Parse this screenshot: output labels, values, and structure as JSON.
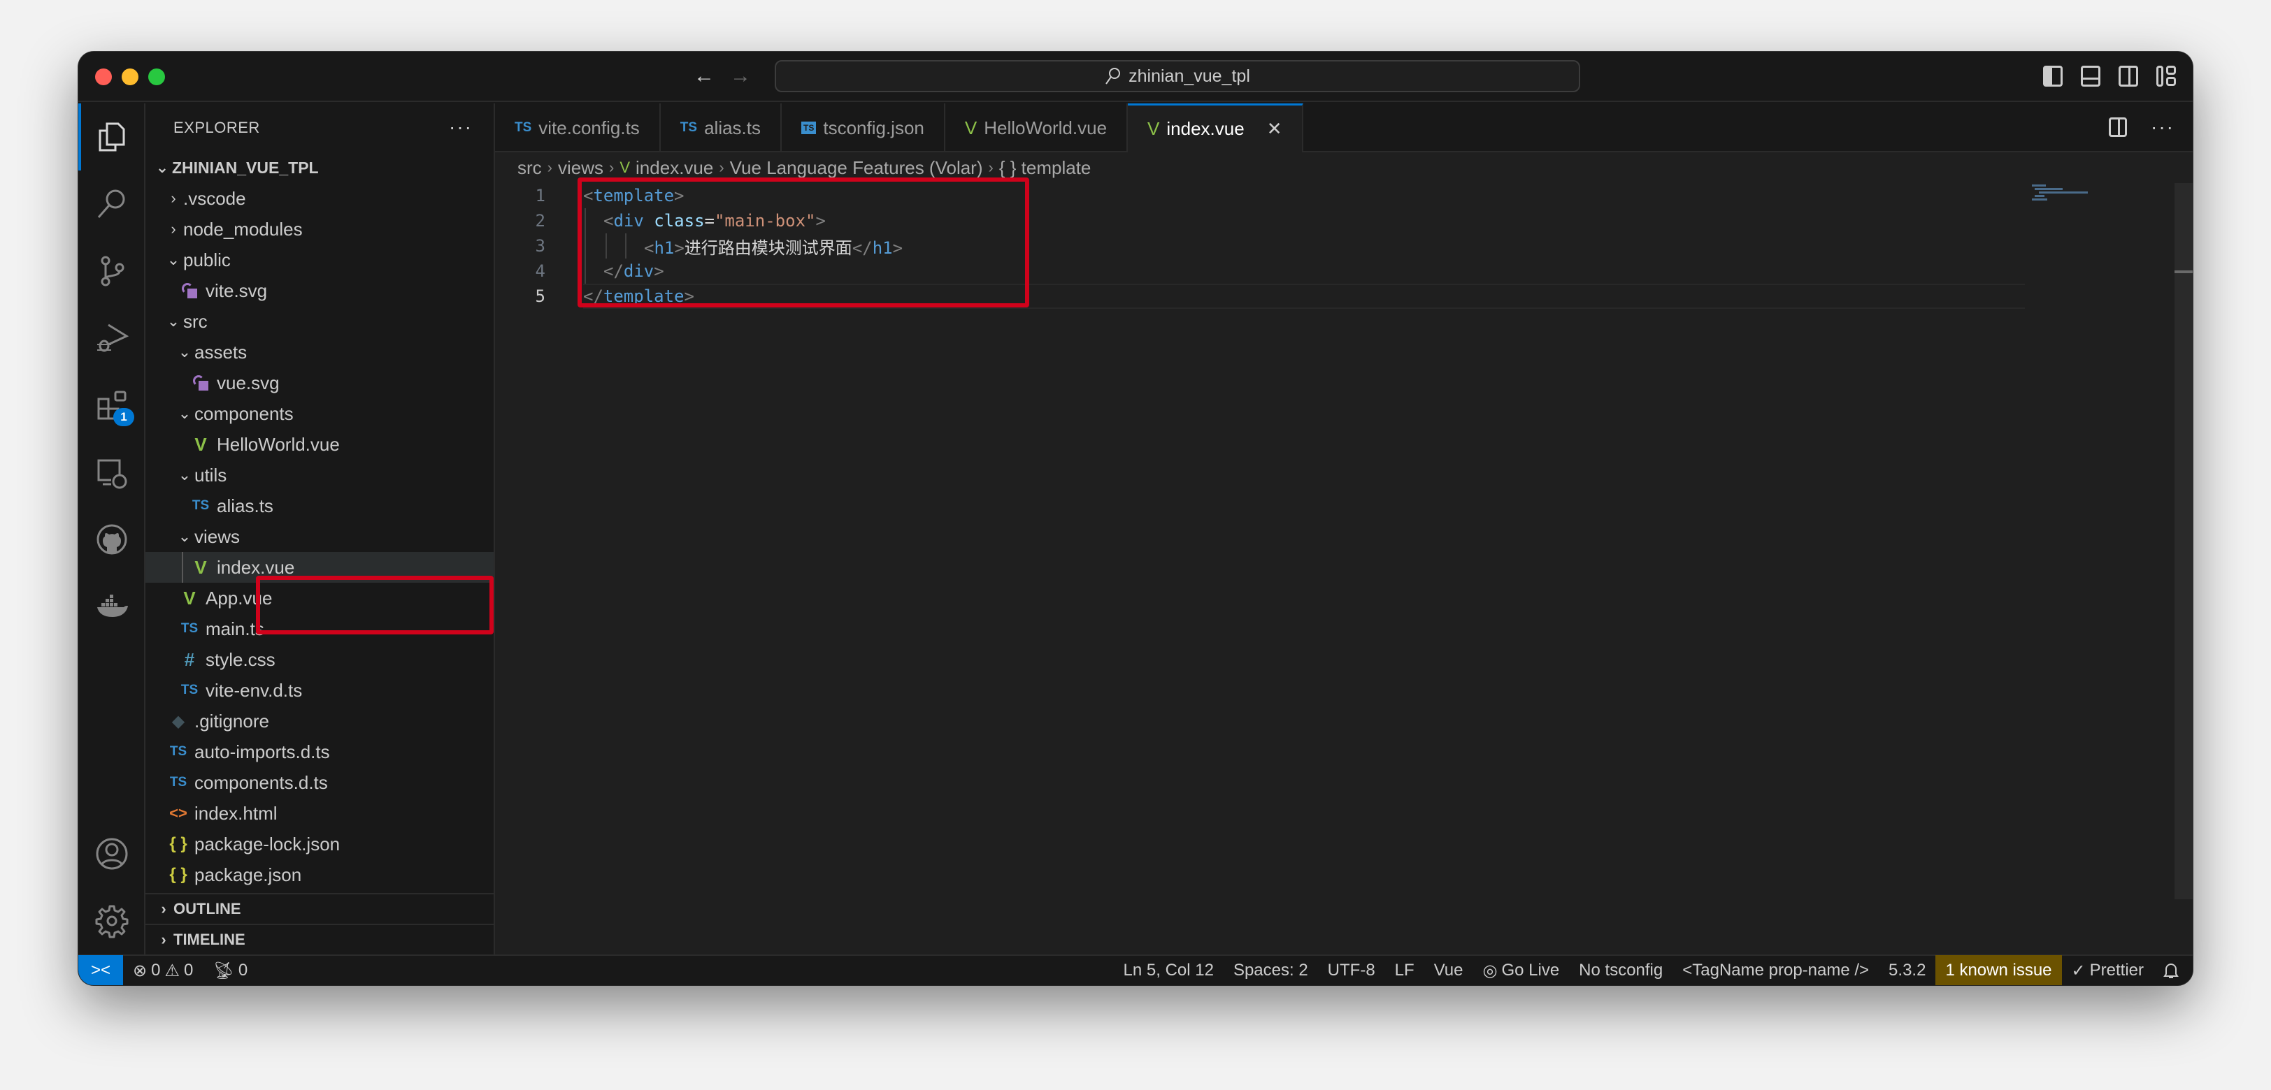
{
  "window": {
    "command_center": "zhinian_vue_tpl"
  },
  "activity_bar": {
    "items": [
      {
        "name": "explorer",
        "active": true
      },
      {
        "name": "search"
      },
      {
        "name": "source-control"
      },
      {
        "name": "run-and-debug"
      },
      {
        "name": "extensions",
        "badge": "1"
      },
      {
        "name": "remote-explorer"
      },
      {
        "name": "github"
      },
      {
        "name": "docker"
      }
    ],
    "bottom": [
      {
        "name": "accounts"
      },
      {
        "name": "manage"
      }
    ]
  },
  "sidebar": {
    "title": "EXPLORER",
    "more": "···",
    "root": "ZHINIAN_VUE_TPL",
    "tree": [
      {
        "label": ".vscode",
        "type": "folder",
        "expanded": false,
        "depth": 1
      },
      {
        "label": "node_modules",
        "type": "folder",
        "expanded": false,
        "depth": 1
      },
      {
        "label": "public",
        "type": "folder",
        "expanded": true,
        "depth": 1
      },
      {
        "label": "vite.svg",
        "type": "svg",
        "depth": 2
      },
      {
        "label": "src",
        "type": "folder",
        "expanded": true,
        "depth": 1
      },
      {
        "label": "assets",
        "type": "folder",
        "expanded": true,
        "depth": 2
      },
      {
        "label": "vue.svg",
        "type": "svg",
        "depth": 3
      },
      {
        "label": "components",
        "type": "folder",
        "expanded": true,
        "depth": 2
      },
      {
        "label": "HelloWorld.vue",
        "type": "vue",
        "depth": 3
      },
      {
        "label": "utils",
        "type": "folder",
        "expanded": true,
        "depth": 2
      },
      {
        "label": "alias.ts",
        "type": "ts",
        "depth": 3
      },
      {
        "label": "views",
        "type": "folder",
        "expanded": true,
        "depth": 2
      },
      {
        "label": "index.vue",
        "type": "vue",
        "depth": 3,
        "selected": true
      },
      {
        "label": "App.vue",
        "type": "vue",
        "depth": 2
      },
      {
        "label": "main.ts",
        "type": "ts",
        "depth": 2
      },
      {
        "label": "style.css",
        "type": "css",
        "depth": 2
      },
      {
        "label": "vite-env.d.ts",
        "type": "ts",
        "depth": 2
      },
      {
        "label": ".gitignore",
        "type": "git",
        "depth": 1
      },
      {
        "label": "auto-imports.d.ts",
        "type": "ts",
        "depth": 1
      },
      {
        "label": "components.d.ts",
        "type": "ts",
        "depth": 1
      },
      {
        "label": "index.html",
        "type": "html",
        "depth": 1
      },
      {
        "label": "package-lock.json",
        "type": "json",
        "depth": 1
      },
      {
        "label": "package.json",
        "type": "json",
        "depth": 1
      }
    ],
    "sections": [
      "OUTLINE",
      "TIMELINE"
    ]
  },
  "icons": {
    "ts": "TS",
    "vue": "V",
    "css": "#",
    "json": "{ }",
    "html": "<>",
    "git": "◆",
    "tsconfig": "TS"
  },
  "tabs": [
    {
      "label": "vite.config.ts",
      "icon": "ts"
    },
    {
      "label": "alias.ts",
      "icon": "ts"
    },
    {
      "label": "tsconfig.json",
      "icon": "tsconfig"
    },
    {
      "label": "HelloWorld.vue",
      "icon": "vue"
    },
    {
      "label": "index.vue",
      "icon": "vue",
      "active": true,
      "close": "✕"
    }
  ],
  "breadcrumb": [
    "src",
    "views",
    "index.vue",
    "Vue Language Features (Volar)",
    "{ } template"
  ],
  "editor": {
    "lines": [
      {
        "n": "1",
        "tokens": [
          [
            "t-br",
            "<"
          ],
          [
            "t-tag",
            "template"
          ],
          [
            "t-br",
            ">"
          ]
        ],
        "indent": 0
      },
      {
        "n": "2",
        "tokens": [
          [
            "t-br",
            "<"
          ],
          [
            "t-tag",
            "div"
          ],
          [
            "t-text",
            " "
          ],
          [
            "t-attr",
            "class"
          ],
          [
            "t-text",
            "="
          ],
          [
            "t-str",
            "\"main-box\""
          ],
          [
            "t-br",
            ">"
          ]
        ],
        "indent": 1
      },
      {
        "n": "3",
        "tokens": [
          [
            "t-br",
            "<"
          ],
          [
            "t-tag",
            "h1"
          ],
          [
            "t-br",
            ">"
          ],
          [
            "t-text",
            "进行路由模块测试界面"
          ],
          [
            "t-br",
            "</"
          ],
          [
            "t-tag",
            "h1"
          ],
          [
            "t-br",
            ">"
          ]
        ],
        "indent": 3
      },
      {
        "n": "4",
        "tokens": [
          [
            "t-br",
            "</"
          ],
          [
            "t-tag",
            "div"
          ],
          [
            "t-br",
            ">"
          ]
        ],
        "indent": 1
      },
      {
        "n": "5",
        "tokens": [
          [
            "t-br",
            "</"
          ],
          [
            "t-tag",
            "template"
          ],
          [
            "t-br",
            ">"
          ]
        ],
        "indent": 0,
        "current": true
      }
    ]
  },
  "statusbar": {
    "remote": "><",
    "errors": "0",
    "warnings": "0",
    "ports": "0",
    "position": "Ln 5, Col 12",
    "spaces": "Spaces: 2",
    "encoding": "UTF-8",
    "eol": "LF",
    "language": "Vue",
    "go_live": "Go Live",
    "tsconfig": "No tsconfig",
    "tag_style": "<TagName prop-name />",
    "version": "5.3.2",
    "known_issue": "1 known issue",
    "prettier": "Prettier",
    "colors": {
      "remote_bg": "#0078d4",
      "issue_bg": "#6b5200"
    }
  }
}
